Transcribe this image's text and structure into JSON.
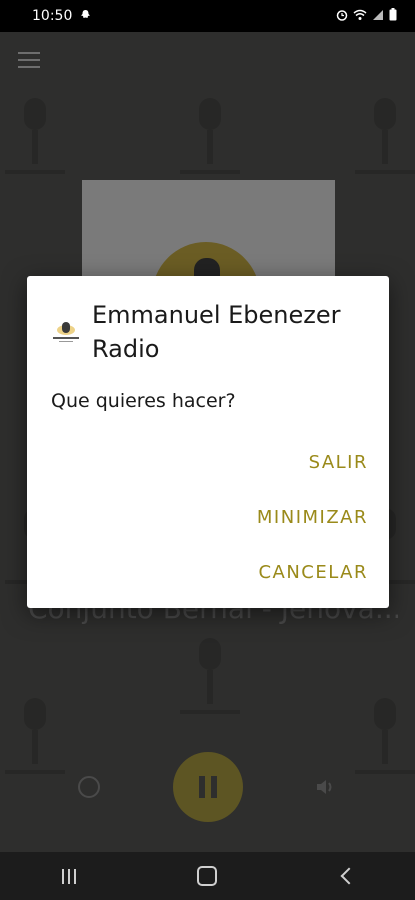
{
  "status_bar": {
    "time": "10:50",
    "notification_icon": "snapchat-ghost-icon",
    "right_icons": [
      "alarm-icon",
      "wifi-icon",
      "signal-icon",
      "battery-icon"
    ]
  },
  "app": {
    "menu_icon": "hamburger-menu-icon",
    "now_playing": "Conjunto Bernal - Jehová...",
    "controls": {
      "alarm_icon": "alarm-clock-icon",
      "play_state_icon": "pause-icon",
      "volume_icon": "volume-icon"
    },
    "accent_color": "#c9b200"
  },
  "dialog": {
    "title": "Emmanuel Ebenezer Radio",
    "message": "Que quieres hacer?",
    "buttons": {
      "exit": "SALIR",
      "minimize": "MINIMIZAR",
      "cancel": "CANCELAR"
    },
    "button_color": "#9a8a1a"
  },
  "nav_bar": {
    "recents_icon": "recents-icon",
    "home_icon": "home-icon",
    "back_icon": "back-icon"
  }
}
